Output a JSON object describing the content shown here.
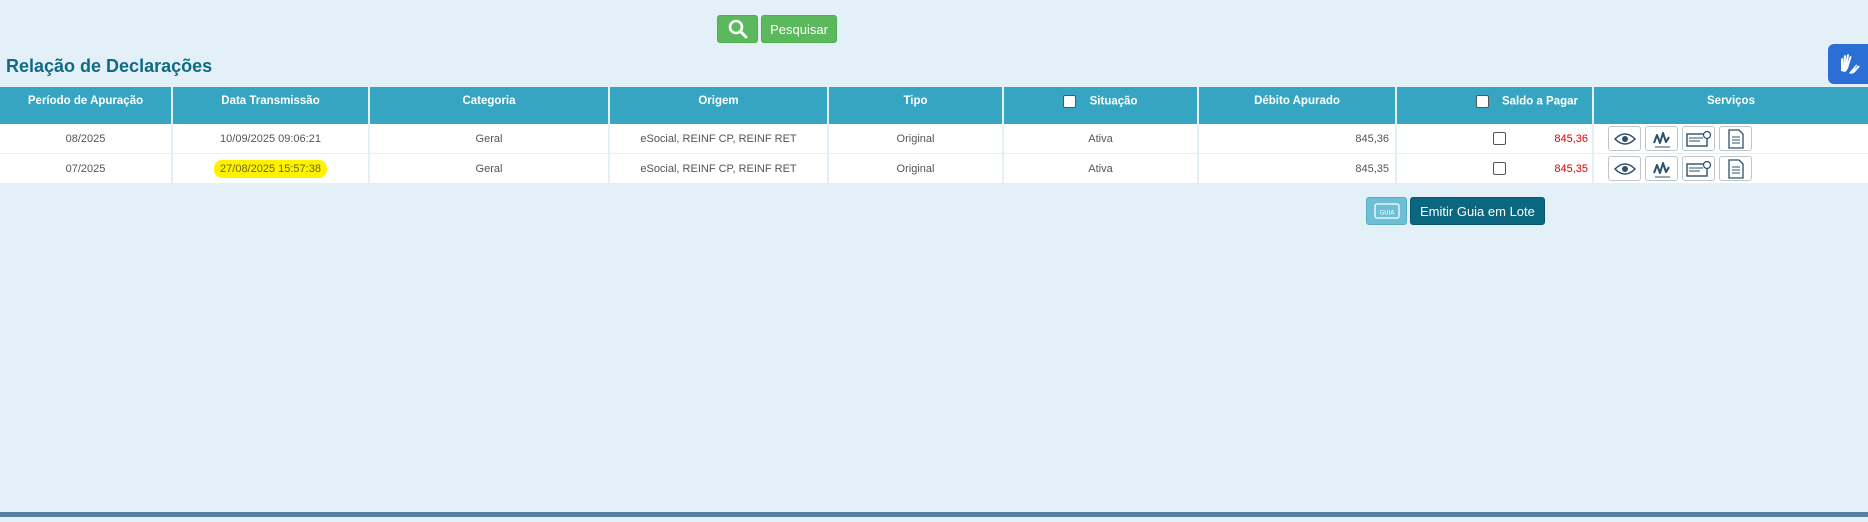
{
  "search": {
    "search_icon": "magnifier-icon",
    "search_label": "Pesquisar"
  },
  "title": "Relação de Declarações",
  "accessibility": {
    "icon": "libras-hands-icon"
  },
  "table": {
    "headers": {
      "periodo": "Período de Apuração",
      "data_transmissao": "Data Transmissão",
      "categoria": "Categoria",
      "origem": "Origem",
      "tipo": "Tipo",
      "situacao": "Situação",
      "debito": "Débito Apurado",
      "saldo": "Saldo a Pagar",
      "servicos": "Serviços"
    },
    "rows": [
      {
        "periodo": "08/2025",
        "data_transmissao": "10/09/2025 09:06:21",
        "categoria": "Geral",
        "origem": "eSocial, REINF CP, REINF RET",
        "tipo": "Original",
        "situacao": "Ativa",
        "debito": "845,36",
        "saldo": "845,36"
      },
      {
        "periodo": "07/2025",
        "data_transmissao": "27/08/2025 15:57:38",
        "categoria": "Geral",
        "origem": "eSocial, REINF CP, REINF RET",
        "tipo": "Original",
        "situacao": "Ativa",
        "debito": "845,35",
        "saldo": "845,35"
      }
    ],
    "service_icons": [
      "eye-icon",
      "signature-icon",
      "payment-slip-icon",
      "document-icon"
    ]
  },
  "actions": {
    "guia_icon": "guia-icon",
    "guia_icon_text": "GUIA",
    "emitir_lote_label": "Emitir Guia em Lote"
  },
  "colors": {
    "background": "#e3f0f7",
    "header": "#35a5c2",
    "title": "#0f6a85",
    "saldo": "#e00000",
    "green_button": "#5cb85c",
    "highlight": "#fff200",
    "lote_button": "#0b6780"
  }
}
